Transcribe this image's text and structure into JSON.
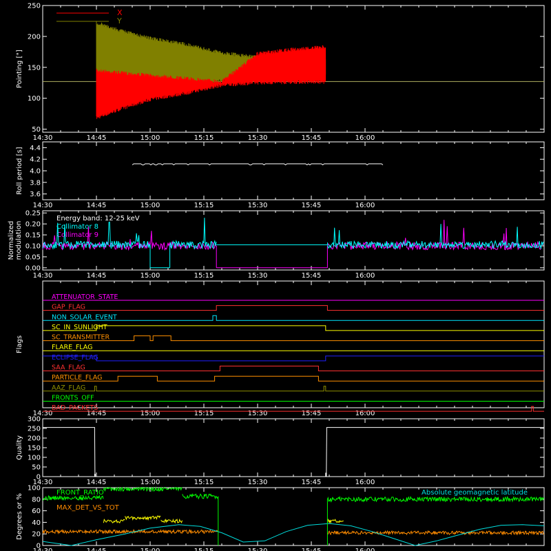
{
  "chart_data": [
    {
      "type": "line",
      "ylabel": "Pointing [\"]",
      "ylim": [
        45,
        250
      ],
      "yticks": [
        50,
        100,
        150,
        200,
        250
      ],
      "xlim": [
        870,
        1010
      ],
      "xticks": [
        "14:30",
        "14:45",
        "15:00",
        "15:15",
        "15:30",
        "15:45",
        "16:00"
      ],
      "xtick_minutes": [
        870,
        885,
        900,
        915,
        930,
        945,
        960
      ],
      "legend": "top-left",
      "colors": {
        "X": "#ff0000",
        "Y": "#808000",
        "guide": "#b0b060"
      },
      "series": [
        {
          "name": "X",
          "x": [
            885,
            892,
            900,
            910,
            920,
            930,
            940,
            949
          ],
          "upper": [
            148,
            144,
            140,
            135,
            130,
            175,
            182,
            186
          ],
          "lower": [
            65,
            80,
            95,
            105,
            118,
            122,
            123,
            123
          ]
        },
        {
          "name": "Y",
          "x": [
            885,
            892,
            900,
            910,
            920,
            930,
            940,
            949
          ],
          "upper": [
            225,
            212,
            200,
            190,
            176,
            170,
            168,
            168
          ],
          "lower": [
            85,
            95,
            105,
            115,
            125,
            130,
            135,
            135
          ]
        }
      ],
      "baseline": 127
    },
    {
      "type": "line",
      "ylabel": "Roll period [s]",
      "ylim": [
        3.5,
        4.5
      ],
      "yticks": [
        "3.6",
        "3.8",
        "4.0",
        "4.2",
        "4.4"
      ],
      "xlim": [
        870,
        1010
      ],
      "xticks": [
        "14:30",
        "14:45",
        "15:00",
        "15:15",
        "15:30",
        "15:45",
        "16:00"
      ],
      "series": [
        {
          "name": "",
          "x": [
            895,
            965
          ],
          "values": [
            4.12,
            4.12
          ]
        }
      ]
    },
    {
      "type": "line",
      "ylabel": "Normalized\nmodulation",
      "ylim": [
        -0.01,
        0.26
      ],
      "yticks": [
        "0.00",
        "0.05",
        "0.10",
        "0.15",
        "0.20",
        "0.25"
      ],
      "xlim": [
        870,
        1010
      ],
      "xticks": [
        "14:30",
        "14:45",
        "15:00",
        "15:15",
        "15:30",
        "15:45",
        "16:00"
      ],
      "annotation": "Energy band: 12-25 keV",
      "legend": "top-left",
      "colors": {
        "Collimator 8": "#00ffff",
        "Collimator 9": "#ff00ff"
      },
      "series": [
        {
          "name": "Collimator 8",
          "segments": [
            [
              870,
              900,
              0.105
            ],
            [
              900,
              905.5,
              0.0
            ],
            [
              905.5,
              918.5,
              0.105
            ],
            [
              949.5,
              1010,
              0.105
            ]
          ]
        },
        {
          "name": "Collimator 9",
          "segments": [
            [
              870,
              918.5,
              0.1
            ],
            [
              918.5,
              949.5,
              0.0
            ],
            [
              949.5,
              1010,
              0.1
            ]
          ]
        }
      ]
    },
    {
      "type": "line",
      "ylabel": "Flags",
      "xlim": [
        870,
        1010
      ],
      "xticks": [
        "14:30",
        "14:45",
        "15:00",
        "15:15",
        "15:30",
        "15:45",
        "16:00"
      ],
      "flags": [
        {
          "name": "ATTENUATOR_STATE",
          "color": "#ff00ff",
          "x": [
            870,
            1010
          ],
          "v": [
            0,
            0
          ]
        },
        {
          "name": "GAP_FLAG",
          "color": "#ff3030",
          "x": [
            870,
            918.5,
            918.5,
            949.5,
            949.5,
            1010
          ],
          "v": [
            0,
            0,
            1,
            1,
            0,
            0
          ]
        },
        {
          "name": "NON_SOLAR_EVENT",
          "color": "#00e8ff",
          "x": [
            870,
            917.5,
            917.5,
            918.5,
            918.5,
            1010
          ],
          "v": [
            0,
            0,
            1,
            1,
            0,
            0
          ]
        },
        {
          "name": "SC_IN_SUNLIGHT",
          "color": "#ffff00",
          "x": [
            870,
            885,
            885,
            949,
            949,
            1010
          ],
          "v": [
            0,
            0,
            1,
            1,
            0,
            0
          ]
        },
        {
          "name": "SC_TRANSMITTER",
          "color": "#ff9000",
          "x": [
            870,
            895.5,
            895.5,
            900,
            900,
            900.8,
            900.8,
            905.8,
            905.8,
            1010
          ],
          "v": [
            0,
            0,
            1,
            1,
            0,
            0,
            1,
            1,
            0,
            0
          ]
        },
        {
          "name": "FLARE_FLAG",
          "color": "#ffff00",
          "x": [
            870,
            1010
          ],
          "v": [
            0,
            0
          ]
        },
        {
          "name": "ECLIPSE_FLAG",
          "color": "#2020ff",
          "x": [
            870,
            885,
            885,
            949,
            949,
            1010
          ],
          "v": [
            1,
            1,
            0,
            0,
            1,
            1
          ]
        },
        {
          "name": "SAA_FLAG",
          "color": "#ff3030",
          "x": [
            870,
            919.5,
            919.5,
            947,
            947,
            1010
          ],
          "v": [
            0,
            0,
            1,
            1,
            0,
            0
          ]
        },
        {
          "name": "PARTICLE_FLAG",
          "color": "#ff9000",
          "x": [
            870,
            891,
            891,
            902,
            902,
            918,
            918,
            947,
            947,
            1010
          ],
          "v": [
            0,
            0,
            1,
            1,
            0,
            0,
            1,
            1,
            0,
            0
          ]
        },
        {
          "name": "AAZ_FLAG",
          "color": "#909000",
          "x": [
            870,
            884.5,
            884.5,
            885,
            885,
            948.5,
            948.5,
            949,
            949,
            1010
          ],
          "v": [
            0,
            0,
            1,
            1,
            0,
            0,
            1,
            1,
            0,
            0
          ]
        },
        {
          "name": "FRONTS_OFF",
          "color": "#00ff00",
          "x": [
            870,
            1010
          ],
          "v": [
            0,
            0
          ]
        },
        {
          "name": "BAD_PACKETS",
          "color": "#ff3030",
          "x": [
            870,
            1006.5,
            1006.5,
            1007,
            1007,
            1010
          ],
          "v": [
            0,
            0,
            1,
            1,
            0,
            0
          ]
        }
      ]
    },
    {
      "type": "line",
      "ylabel": "Quality",
      "ylim": [
        0,
        300
      ],
      "yticks": [
        0,
        50,
        100,
        150,
        200,
        250,
        300
      ],
      "xlim": [
        870,
        1010
      ],
      "xticks": [
        "14:30",
        "14:45",
        "15:00",
        "15:15",
        "15:30",
        "15:45",
        "16:00"
      ],
      "series": [
        {
          "name": "",
          "x": [
            870,
            884.5,
            884.6,
            949.2,
            949.3,
            1010
          ],
          "values": [
            255,
            255,
            0,
            0,
            255,
            255
          ]
        }
      ]
    },
    {
      "type": "line",
      "ylabel": "Degrees or %",
      "ylim": [
        0,
        100
      ],
      "yticks": [
        0,
        20,
        40,
        60,
        80,
        100
      ],
      "xlim": [
        870,
        1010
      ],
      "xticks": [
        "14:30",
        "14:45",
        "15:00",
        "15:15",
        "15:30",
        "15:45",
        "16:00"
      ],
      "legend": "top-left",
      "series": [
        {
          "name": "FRONT_RATIO",
          "color": "#00ff00",
          "segments": [
            [
              870,
              887,
              82
            ],
            [
              887,
              909,
              98
            ],
            [
              909,
              919,
              85
            ],
            [
              949.5,
              1010,
              80
            ]
          ]
        },
        {
          "name": "",
          "color": "#ffff00",
          "segments": [
            [
              887,
              893,
              42
            ],
            [
              893,
              903,
              48
            ],
            [
              903,
              909,
              42
            ],
            [
              949.5,
              954,
              42
            ]
          ]
        },
        {
          "name": "MAX_DET_VS_TOT",
          "color": "#ff8c00",
          "segments": [
            [
              870,
              919,
              24
            ],
            [
              949.5,
              1010,
              22
            ]
          ]
        },
        {
          "name": "Absolute geomagnetic latitude",
          "color": "#00e0e0",
          "x": [
            870,
            878,
            885,
            893,
            900,
            908,
            914,
            920,
            926,
            932,
            938,
            944,
            950,
            956,
            962,
            968,
            974,
            980,
            986,
            992,
            998,
            1004,
            1010
          ],
          "values": [
            7,
            0,
            10,
            20,
            30,
            36,
            33,
            22,
            6,
            8,
            24,
            35,
            38,
            34,
            24,
            12,
            0,
            8,
            18,
            28,
            35,
            36,
            34
          ]
        }
      ]
    }
  ]
}
